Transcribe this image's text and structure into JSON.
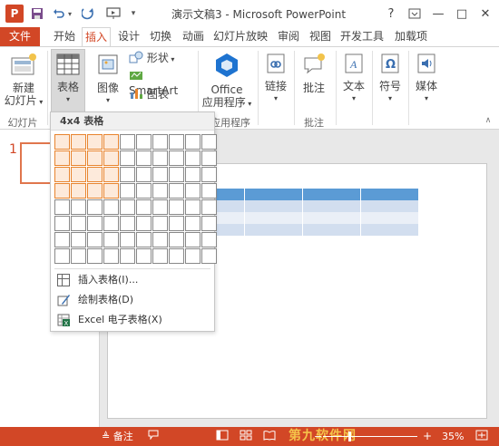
{
  "titlebar": {
    "app_icon": "P",
    "title": "演示文稿3 - Microsoft PowerPoint",
    "help": "?",
    "restore_icon": "ribbon-display-icon",
    "minimize": "—",
    "maximize": "□",
    "close": "✕"
  },
  "tabs": [
    "文件",
    "开始",
    "插入",
    "设计",
    "切换",
    "动画",
    "幻灯片放映",
    "审阅",
    "视图",
    "开发工具",
    "加载项"
  ],
  "ribbon": {
    "new_slide_line1": "新建",
    "new_slide_line2": "幻灯片",
    "table": "表格",
    "image": "图像",
    "shapes": "形状",
    "smartart": "SmartArt",
    "chart": "图表",
    "office_line1": "Office",
    "office_line2": "应用程序",
    "link": "链接",
    "comment": "批注",
    "text": "文本",
    "symbol": "符号",
    "media": "媒体",
    "group_slides": "幻灯片",
    "group_apps": "应用程序",
    "group_comments": "批注"
  },
  "dropdown": {
    "header": "4x4 表格",
    "grid_cols": 10,
    "grid_rows": 8,
    "selected_cols": 4,
    "selected_rows": 4,
    "items": [
      "插入表格(I)...",
      "绘制表格(D)",
      "Excel 电子表格(X)"
    ]
  },
  "slides_pane": {
    "slide_number": "1"
  },
  "statusbar": {
    "notes": "备注",
    "zoom": "35%",
    "watermark": "第九软件网"
  },
  "colors": {
    "accent": "#d24726",
    "grid_highlight": "#e8842e",
    "table_header": "#5b9bd5",
    "table_row1": "#d2deef",
    "table_row2": "#eaeff7"
  }
}
